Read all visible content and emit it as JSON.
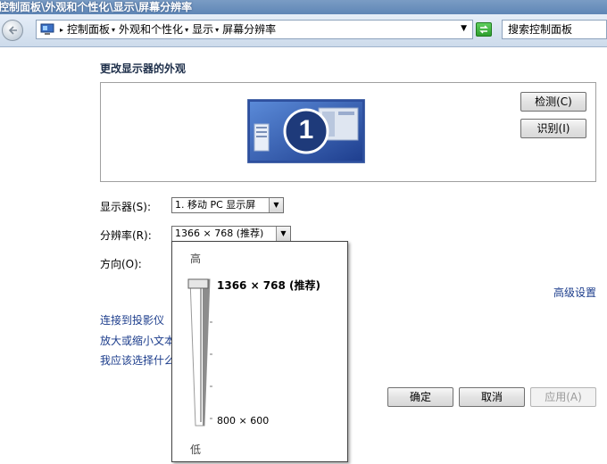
{
  "window": {
    "title": "控制面板\\外观和个性化\\显示\\屏幕分辨率"
  },
  "address": {
    "crumbs": [
      "控制面板",
      "外观和个性化",
      "显示",
      "屏幕分辨率"
    ],
    "search_placeholder": "搜索控制面板"
  },
  "main": {
    "title": "更改显示器的外观",
    "detect_label": "检测(C)",
    "identify_label": "识别(I)",
    "monitor_number": "1",
    "display_label": "显示器(S):",
    "display_value": "1. 移动 PC 显示屏",
    "resolution_label": "分辨率(R):",
    "resolution_value": "1366 × 768 (推荐)",
    "orientation_label": "方向(O):",
    "advanced_link": "高级设置",
    "links": [
      "连接到投影仪",
      "放大或缩小文本",
      "我应该选择什么"
    ],
    "ok_label": "确定",
    "cancel_label": "取消",
    "apply_label": "应用(A)"
  },
  "slider": {
    "high_label": "高",
    "low_label": "低",
    "top_resolution": "1366 × 768 (推荐)",
    "bottom_resolution": "800 × 600",
    "level_fraction": 1.0
  },
  "colors": {
    "link": "#1c3d8c",
    "title_bar": "#5f86b6"
  },
  "icons": [
    "back-arrow-icon",
    "control-panel-icon",
    "chevron-down-icon",
    "refresh-icon",
    "monitor-icon"
  ]
}
